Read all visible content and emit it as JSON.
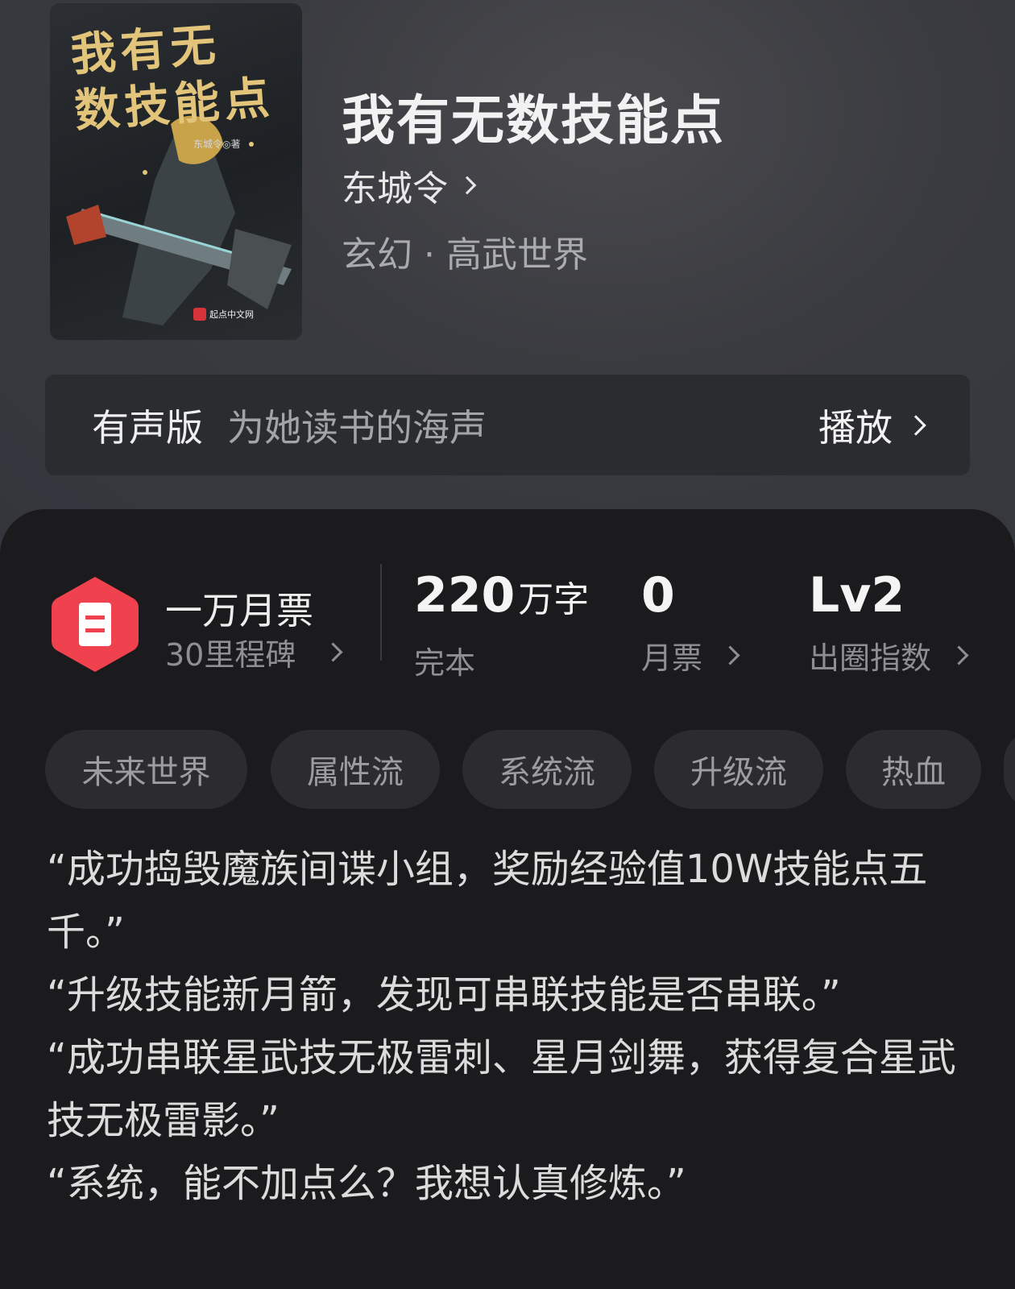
{
  "cover": {
    "title_line1": "我有无",
    "title_line2": "数技能点",
    "author_credit": "东城令◎著",
    "publisher_badge": "起点中文网"
  },
  "book": {
    "title": "我有无数技能点",
    "author": "东城令",
    "genre": "玄幻 · 高武世界"
  },
  "audio": {
    "label": "有声版",
    "description": "为她读书的海声",
    "play_label": "播放"
  },
  "milestone": {
    "title": "一万月票",
    "subtitle": "30里程碑"
  },
  "stats": {
    "words_value": "220",
    "words_unit": "万字",
    "words_status": "完本",
    "monthly_value": "0",
    "monthly_label": "月票",
    "level_value": "Lv2",
    "level_label": "出圈指数"
  },
  "tags": [
    "未来世界",
    "属性流",
    "系统流",
    "升级流",
    "热血"
  ],
  "description": [
    "“成功捣毁魔族间谍小组，奖励经验值10W技能点五千。”",
    "“升级技能新月箭，发现可串联技能是否串联。”",
    "",
    "“成功串联星武技无极雷刺、星月剑舞，获得复合星武技无极雷影。”",
    "“系统，能不加点么？我想认真修炼。”"
  ],
  "colors": {
    "accent_red": "#f0424e",
    "cover_title_gold": "#e2c57a"
  }
}
